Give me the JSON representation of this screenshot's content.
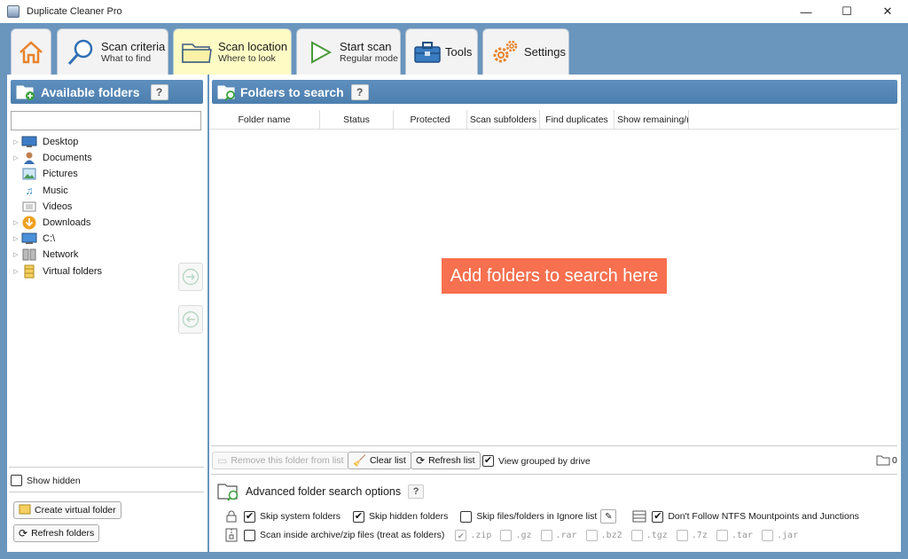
{
  "window": {
    "title": "Duplicate Cleaner Pro",
    "minimize": "—",
    "maximize": "☐",
    "close": "✕"
  },
  "tabs": [
    {
      "title": "",
      "subtitle": "",
      "icon": "home-icon"
    },
    {
      "title": "Scan criteria",
      "subtitle": "What to find",
      "icon": "magnifier-icon"
    },
    {
      "title": "Scan location",
      "subtitle": "Where to look",
      "icon": "folder-icon",
      "active": true
    },
    {
      "title": "Start scan",
      "subtitle": "Regular mode",
      "icon": "play-icon"
    },
    {
      "title": "Tools",
      "subtitle": "",
      "icon": "toolbox-icon"
    },
    {
      "title": "Settings",
      "subtitle": "",
      "icon": "gears-icon"
    }
  ],
  "left": {
    "header": "Available folders",
    "help": "?",
    "search_value": "",
    "tree": [
      {
        "label": "Desktop",
        "icon": "desktop-icon",
        "expandable": true
      },
      {
        "label": "Documents",
        "icon": "documents-icon",
        "expandable": true
      },
      {
        "label": "Pictures",
        "icon": "pictures-icon",
        "expandable": false
      },
      {
        "label": "Music",
        "icon": "music-icon",
        "expandable": false
      },
      {
        "label": "Videos",
        "icon": "videos-icon",
        "expandable": false
      },
      {
        "label": "Downloads",
        "icon": "downloads-icon",
        "expandable": true
      },
      {
        "label": "C:\\",
        "icon": "drive-icon",
        "expandable": true
      },
      {
        "label": "Network",
        "icon": "network-icon",
        "expandable": true
      },
      {
        "label": "Virtual folders",
        "icon": "virtual-folders-icon",
        "expandable": true
      }
    ],
    "show_hidden": "Show hidden",
    "create_virtual": "Create virtual folder",
    "refresh_folders": "Refresh folders"
  },
  "right": {
    "header": "Folders to search",
    "help": "?",
    "columns": [
      "Folder name",
      "Status",
      "Protected",
      "Scan subfolders",
      "Find duplicates",
      "Show remaining/("
    ],
    "empty_hint": "Add folders to search here",
    "remove_btn": "Remove this folder from list",
    "clear_btn": "Clear list",
    "refresh_btn": "Refresh list",
    "view_grouped": "View grouped by drive",
    "folder_count": "0",
    "advanced_title": "Advanced folder search options",
    "advanced_help": "?",
    "skip_system": "Skip system folders",
    "skip_hidden": "Skip hidden folders",
    "skip_ignore": "Skip files/folders in Ignore list",
    "dont_follow": "Don't Follow NTFS Mountpoints and Junctions",
    "scan_archive": "Scan inside archive/zip files (treat as folders)",
    "extensions": [
      ".zip",
      ".gz",
      ".rar",
      ".bz2",
      ".tgz",
      ".7z",
      ".tar",
      ".jar"
    ]
  },
  "colors": {
    "accent_blue": "#5e8fbe",
    "active_tab": "#fffbc4",
    "hint_orange": "#f7704f"
  }
}
